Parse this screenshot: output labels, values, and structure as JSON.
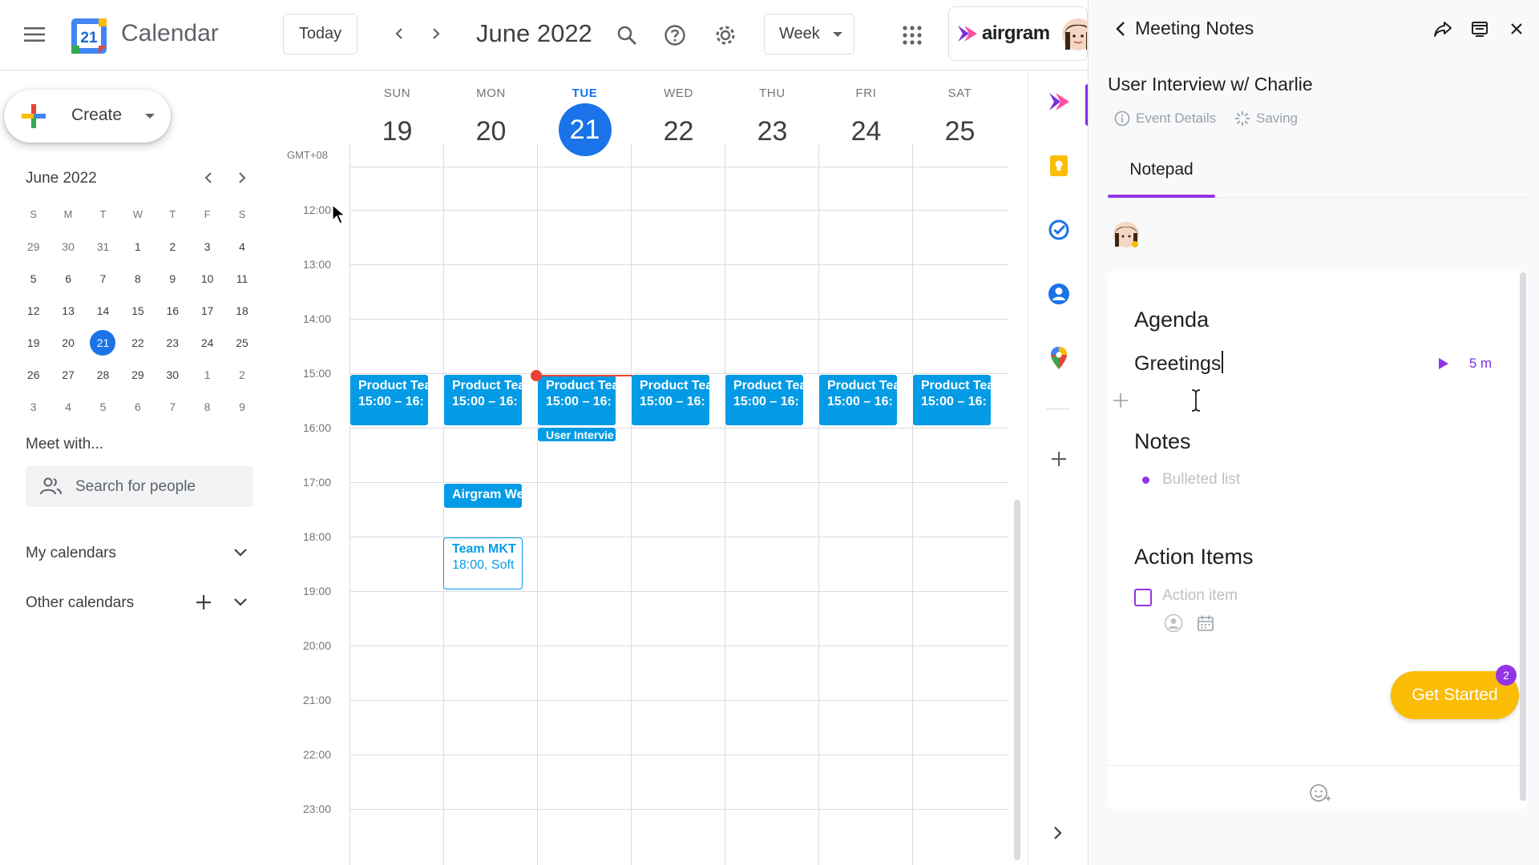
{
  "header": {
    "app_name": "Calendar",
    "logo_day": "21",
    "today_label": "Today",
    "month_title": "June 2022",
    "view_label": "Week",
    "airgram_label": "airgram"
  },
  "sidebar": {
    "create_label": "Create",
    "mini_cal": {
      "title": "June 2022",
      "dow": [
        "S",
        "M",
        "T",
        "W",
        "T",
        "F",
        "S"
      ],
      "weeks": [
        [
          "29",
          "30",
          "31",
          "1",
          "2",
          "3",
          "4"
        ],
        [
          "5",
          "6",
          "7",
          "8",
          "9",
          "10",
          "11"
        ],
        [
          "12",
          "13",
          "14",
          "15",
          "16",
          "17",
          "18"
        ],
        [
          "19",
          "20",
          "21",
          "22",
          "23",
          "24",
          "25"
        ],
        [
          "26",
          "27",
          "28",
          "29",
          "30",
          "1",
          "2"
        ],
        [
          "3",
          "4",
          "5",
          "6",
          "7",
          "8",
          "9"
        ]
      ]
    },
    "meet_with": "Meet with...",
    "search_people_placeholder": "Search for people",
    "my_calendars": "My calendars",
    "other_calendars": "Other calendars"
  },
  "week": {
    "timezone": "GMT+08",
    "days": [
      {
        "name": "SUN",
        "date": "19"
      },
      {
        "name": "MON",
        "date": "20"
      },
      {
        "name": "TUE",
        "date": "21"
      },
      {
        "name": "WED",
        "date": "22"
      },
      {
        "name": "THU",
        "date": "23"
      },
      {
        "name": "FRI",
        "date": "24"
      },
      {
        "name": "SAT",
        "date": "25"
      }
    ],
    "times": [
      "12:00",
      "13:00",
      "14:00",
      "15:00",
      "16:00",
      "17:00",
      "18:00",
      "19:00",
      "20:00",
      "21:00",
      "22:00",
      "23:00"
    ],
    "events": {
      "product_title": "Product Tea",
      "product_time": "15:00 – 16:",
      "user_interview": "User Intervie",
      "airgram_web": "Airgram We",
      "team_mkt_title": "Team MKT",
      "team_mkt_time": "18:00, Soft"
    }
  },
  "panel": {
    "title": "Meeting Notes",
    "meeting_title": "User Interview w/ Charlie",
    "event_details": "Event Details",
    "saving": "Saving",
    "tab_notepad": "Notepad",
    "agenda_heading": "Agenda",
    "agenda_item": "Greetings",
    "agenda_duration": "5 m",
    "notes_heading": "Notes",
    "bullet_placeholder": "Bulleted list",
    "action_heading": "Action Items",
    "action_placeholder": "Action item",
    "get_started": "Get Started",
    "badge_count": "2"
  },
  "colors": {
    "accent_blue": "#1a73e8",
    "event_blue": "#039be5",
    "airgram_purple": "#9334e6",
    "get_started_yellow": "#fbbc04",
    "now_red": "#ea4335"
  }
}
